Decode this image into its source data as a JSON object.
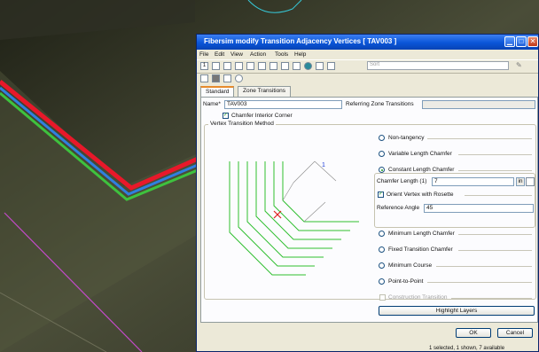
{
  "window": {
    "title": "Fibersim  modify Transition Adjacency Vertices [ TAV003 ]",
    "controls": [
      "minimize",
      "maximize",
      "close"
    ]
  },
  "menu": [
    "File",
    "Edit",
    "View",
    "Action",
    "Tools",
    "Help"
  ],
  "toolbar": {
    "first_item": "1",
    "sort_placeholder": "Sort"
  },
  "tabs": [
    {
      "label": "Standard",
      "active": true
    },
    {
      "label": "Zone Transitions",
      "active": false
    }
  ],
  "form": {
    "name_label": "Name*",
    "name_value": "TAV003",
    "ref_zone_label": "Referring Zone Transitions",
    "ref_zone_value": "",
    "chamfer_interior_label": "Chamfer Interior Corner",
    "chamfer_interior_checked": true,
    "method_group_label": "Vertex Transition Method",
    "options": [
      {
        "label": "Non-tangency",
        "selected": false
      },
      {
        "label": "Variable Length Chamfer",
        "selected": false
      },
      {
        "label": "Constant Length Chamfer",
        "selected": true
      },
      {
        "label": "Minimum Length Chamfer",
        "selected": false
      },
      {
        "label": "Fixed Transition Chamfer",
        "selected": false
      },
      {
        "label": "Minimum Course",
        "selected": false
      },
      {
        "label": "Point-to-Point",
        "selected": false
      }
    ],
    "chamfer_length_label": "Chamfer Length (1)",
    "chamfer_length_value": "7",
    "unit_label": "in",
    "orient_vertex_label": "Orient Vertex with Rosette",
    "orient_vertex_checked": true,
    "reference_angle_label": "Reference Angle",
    "reference_angle_value": "45",
    "construction_transition_label": "Construction Transition",
    "construction_transition_checked": false,
    "highlight_button": "Highlight Layers",
    "diagram_dimension_label": "1"
  },
  "buttons": {
    "ok": "OK",
    "cancel": "Cancel"
  },
  "status": {
    "text": "1 selected, 1 shown, 7 available"
  },
  "colors": {
    "viewport_bg": "#3a3d2c",
    "title_blue": "#0a55d8",
    "ply_red": "#e8182a",
    "ply_blue": "#2f7fe0",
    "ply_green": "#3ec23e",
    "diagram_green": "#2fbf2f",
    "marker_red": "#e02020"
  }
}
